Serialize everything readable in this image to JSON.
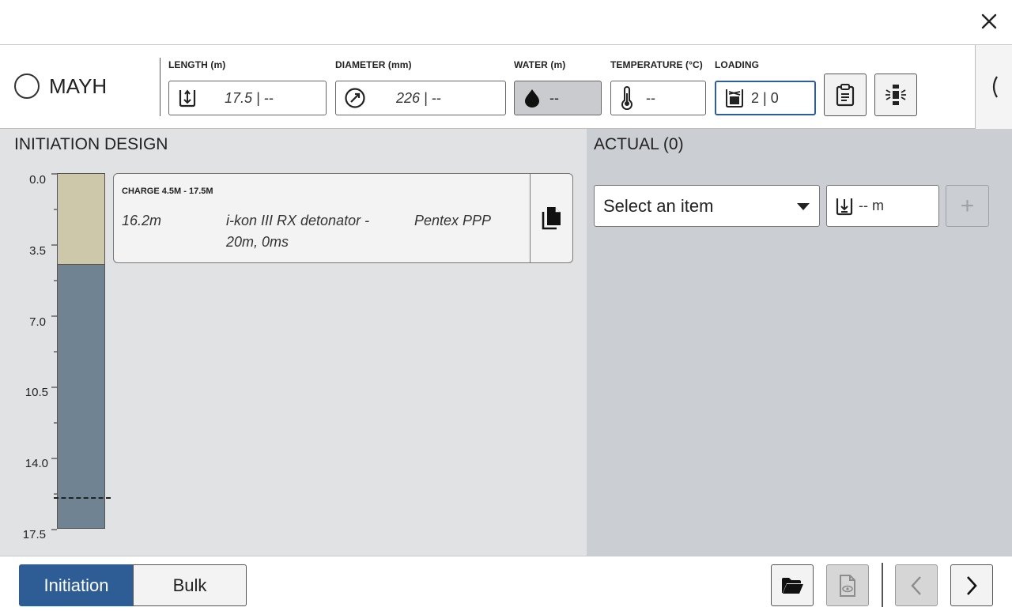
{
  "header": {
    "hole_name": "MAYH",
    "fields": {
      "length": {
        "label": "LENGTH (m)",
        "value": "17.5 | --"
      },
      "diameter": {
        "label": "DIAMETER (mm)",
        "value": "226 | --"
      },
      "water": {
        "label": "WATER (m)",
        "value": "--"
      },
      "temperature": {
        "label": "TEMPERATURE (°C)",
        "value": "--"
      },
      "loading": {
        "label": "LOADING",
        "value": "2 | 0"
      }
    }
  },
  "design": {
    "title": "INITIATION DESIGN",
    "axis_ticks": [
      "0.0",
      "3.5",
      "7.0",
      "10.5",
      "14.0",
      "17.5"
    ],
    "charge": {
      "title": "CHARGE 4.5M - 17.5M",
      "depth": "16.2m",
      "detonator_line1": "i-kon III RX detonator -",
      "detonator_line2": "20m, 0ms",
      "booster": "Pentex PPP"
    }
  },
  "actual": {
    "title": "ACTUAL (0)",
    "select_placeholder": "Select an item",
    "depth_value": "-- m",
    "add_label": "+"
  },
  "footer": {
    "tab_initiation": "Initiation",
    "tab_bulk": "Bulk"
  },
  "colors": {
    "accent": "#2d5d94",
    "stemming": "#cec8aa",
    "charge": "#6f8393",
    "left_panel": "#e1e2e4",
    "right_panel": "#cbced2"
  }
}
